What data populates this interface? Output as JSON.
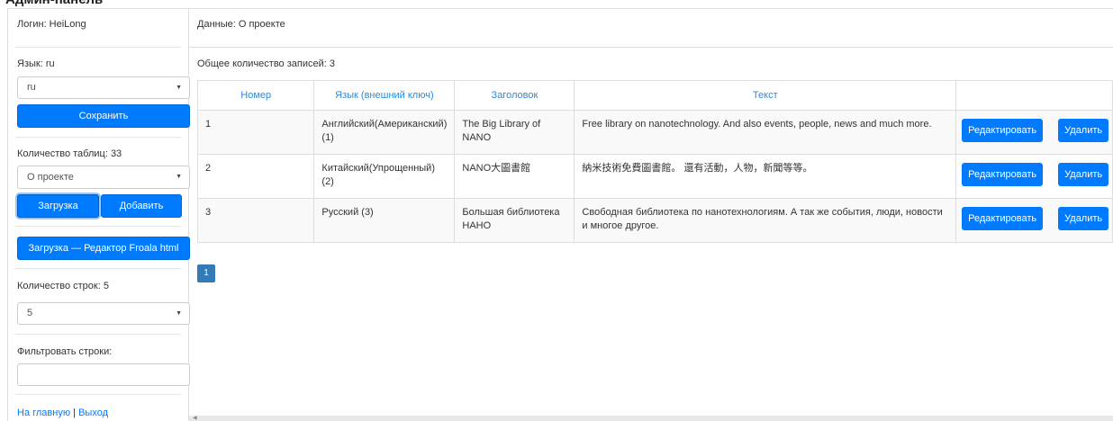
{
  "header": {
    "title": "Админ-панель"
  },
  "sidebar": {
    "login_label": "Логин: HeiLong",
    "language_label": "Язык: ru",
    "language_select": "ru",
    "save_button": "Сохранить",
    "tables_count_label": "Количество таблиц: 33",
    "table_select": "О проекте",
    "load_button": "Загрузка",
    "add_button": "Добавить",
    "froala_button": "Загрузка — Редактор Froala html",
    "rows_count_label": "Количество строк: 5",
    "rows_select": "5",
    "filter_label": "Фильтровать строки:",
    "filter_value": "",
    "home_link": "На главную",
    "separator": "|",
    "logout_link": "Выход"
  },
  "main": {
    "title": "Данные: О проекте",
    "total_records": "Общее количество записей: 3",
    "columns": [
      "Номер",
      "Язык (внешний ключ)",
      "Заголовок",
      "Текст",
      ""
    ],
    "rows": [
      {
        "number": "1",
        "language": "Английский(Американский) (1)",
        "heading": "The Big Library of NANO",
        "text": "Free library on nanotechnology. And also events, people, news and much more.",
        "edit": "Редактировать",
        "delete": "Удалить"
      },
      {
        "number": "2",
        "language": "Китайский(Упрощенный) (2)",
        "heading": "NANO大圖書館",
        "text": "納米技術免費圖書館。 還有活動，人物，新聞等等。",
        "edit": "Редактировать",
        "delete": "Удалить"
      },
      {
        "number": "3",
        "language": "Русский (3)",
        "heading": "Большая библиотека НАНО",
        "text": "Свободная библиотека по нанотехнологиям. А так же события, люди, новости и многое другое.",
        "edit": "Редактировать",
        "delete": "Удалить"
      }
    ],
    "pagination": {
      "current_page": "1"
    }
  },
  "colors": {
    "accent": "#007bff",
    "link": "#2a8ade",
    "pager": "#337ab7",
    "border": "#dddddd"
  },
  "icons": {
    "select_caret": "caret-down-icon",
    "scroll_left": "scroll-left-arrow-icon"
  }
}
